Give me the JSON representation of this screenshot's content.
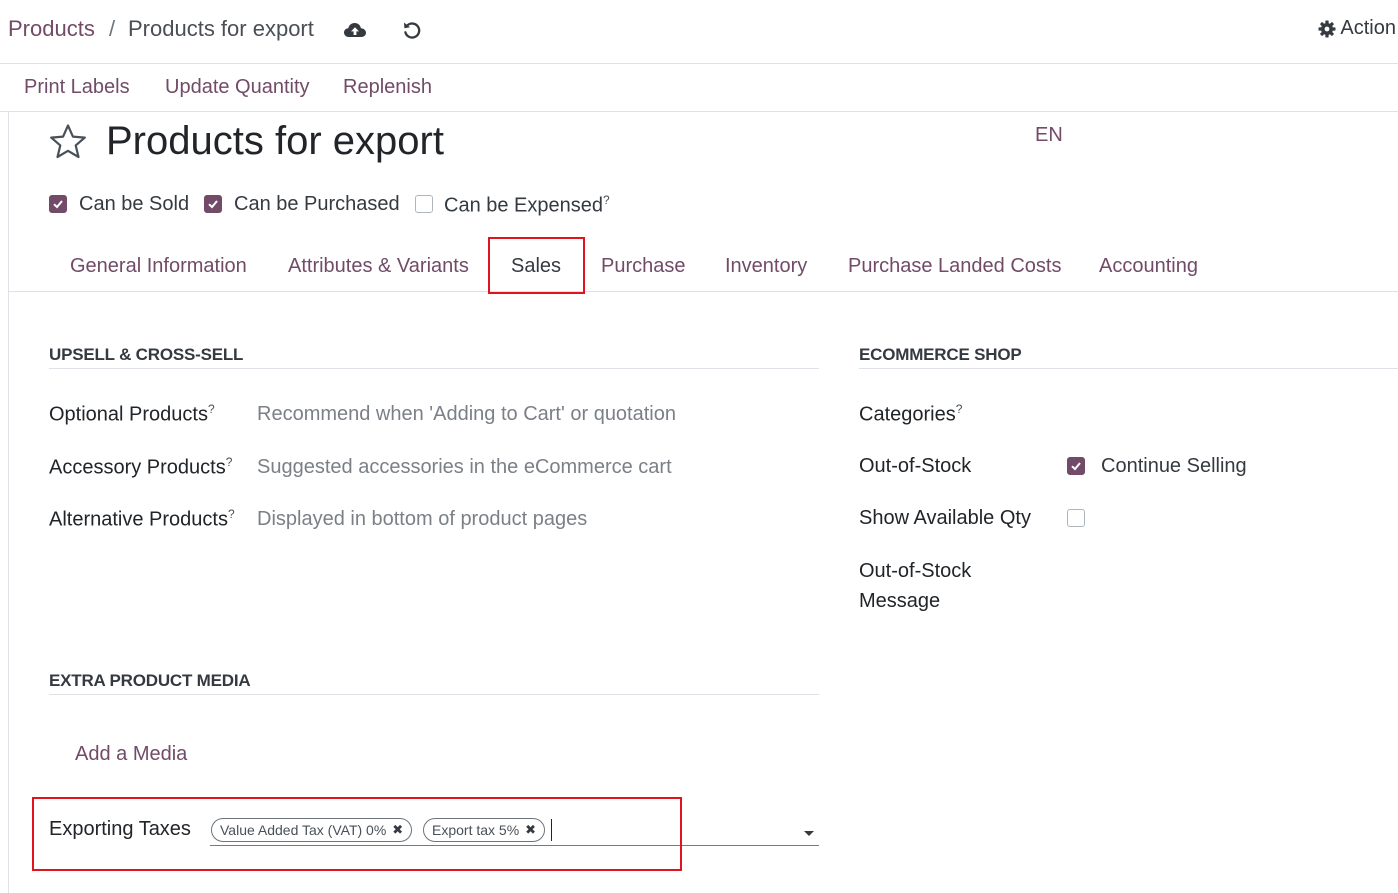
{
  "breadcrumb": {
    "root": "Products",
    "separator": "/",
    "current": "Products for export"
  },
  "header_actions": {
    "action_label": "Action"
  },
  "control_buttons": [
    "Print Labels",
    "Update Quantity",
    "Replenish"
  ],
  "product": {
    "name": "Products for export",
    "language": "EN",
    "flags": [
      {
        "label": "Can be Sold",
        "checked": true,
        "help": ""
      },
      {
        "label": "Can be Purchased",
        "checked": true,
        "help": ""
      },
      {
        "label": "Can be Expensed",
        "checked": false,
        "help": "?"
      }
    ]
  },
  "tabs": [
    "General Information",
    "Attributes & Variants",
    "Sales",
    "Purchase",
    "Inventory",
    "Purchase Landed Costs",
    "Accounting"
  ],
  "active_tab": "Sales",
  "upsell": {
    "title": "UPSELL & CROSS-SELL",
    "fields": [
      {
        "label": "Optional Products",
        "help": "?",
        "placeholder": "Recommend when 'Adding to Cart' or quotation"
      },
      {
        "label": "Accessory Products",
        "help": "?",
        "placeholder": "Suggested accessories in the eCommerce cart"
      },
      {
        "label": "Alternative Products",
        "help": "?",
        "placeholder": "Displayed in bottom of product pages"
      }
    ]
  },
  "ecommerce": {
    "title": "ECOMMERCE SHOP",
    "categories_label": "Categories",
    "categories_help": "?",
    "out_of_stock_label": "Out-of-Stock",
    "continue_selling_label": "Continue Selling",
    "continue_selling_checked": true,
    "show_qty_label": "Show Available Qty",
    "show_qty_checked": false,
    "oos_message_label_line1": "Out-of-Stock",
    "oos_message_label_line2": "Message"
  },
  "media": {
    "title": "EXTRA PRODUCT MEDIA",
    "add_label": "Add a Media"
  },
  "taxes": {
    "label": "Exporting Taxes",
    "tags": [
      "Value Added Tax (VAT) 0%",
      "Export tax 5%"
    ]
  },
  "colors": {
    "accent": "#714b67",
    "highlight": "#e0141e",
    "focus_line": "#2a9d8f"
  },
  "icons": [
    "cloud-upload-icon",
    "undo-icon",
    "gear-icon",
    "star-icon",
    "check-icon",
    "remove-tag-icon",
    "caret-down-icon"
  ]
}
